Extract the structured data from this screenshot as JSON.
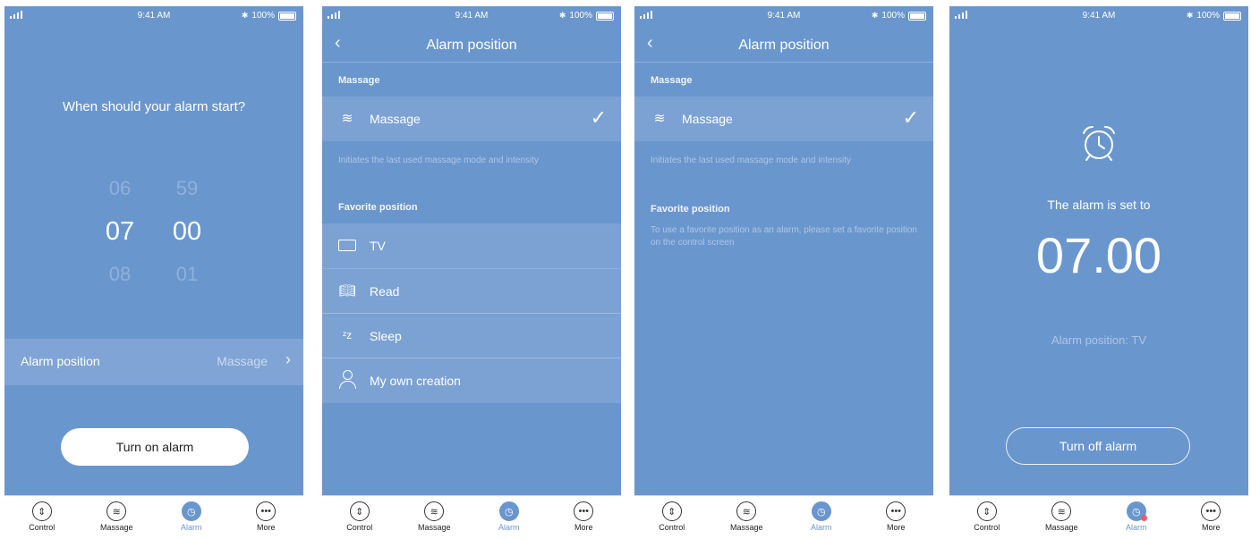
{
  "status": {
    "time": "9:41 AM",
    "battery": "100%"
  },
  "tabs": [
    "Control",
    "Massage",
    "Alarm",
    "More"
  ],
  "screen1": {
    "question": "When should your alarm start?",
    "hours": {
      "prev": "06",
      "selected": "07",
      "next": "08"
    },
    "minutes": {
      "prev": "59",
      "selected": "00",
      "next": "01"
    },
    "alarm_position_label": "Alarm position",
    "alarm_position_value": "Massage",
    "button": "Turn on alarm"
  },
  "screen2": {
    "title": "Alarm position",
    "massage_section": "Massage",
    "massage_item": "Massage",
    "massage_hint": "Initiates the last used massage mode and intensity",
    "favorite_section": "Favorite position",
    "favorites": [
      {
        "label": "TV",
        "icon": "tv-icon"
      },
      {
        "label": "Read",
        "icon": "book-icon"
      },
      {
        "label": "Sleep",
        "icon": "sleep-icon"
      },
      {
        "label": "My own creation",
        "icon": "person-icon"
      }
    ]
  },
  "screen3": {
    "title": "Alarm position",
    "massage_section": "Massage",
    "massage_item": "Massage",
    "massage_hint": "Initiates the last used massage mode and intensity",
    "favorite_section": "Favorite position",
    "favorite_hint": "To use a favorite position as an alarm, please set a favorite position on the control screen"
  },
  "screen4": {
    "set_to": "The alarm is set to",
    "time": "07.00",
    "position": "Alarm position: TV",
    "button": "Turn off alarm"
  },
  "colors": {
    "background": "#6a96ce",
    "tab_active": "#6a96ce",
    "badge": "#ef5a66"
  }
}
